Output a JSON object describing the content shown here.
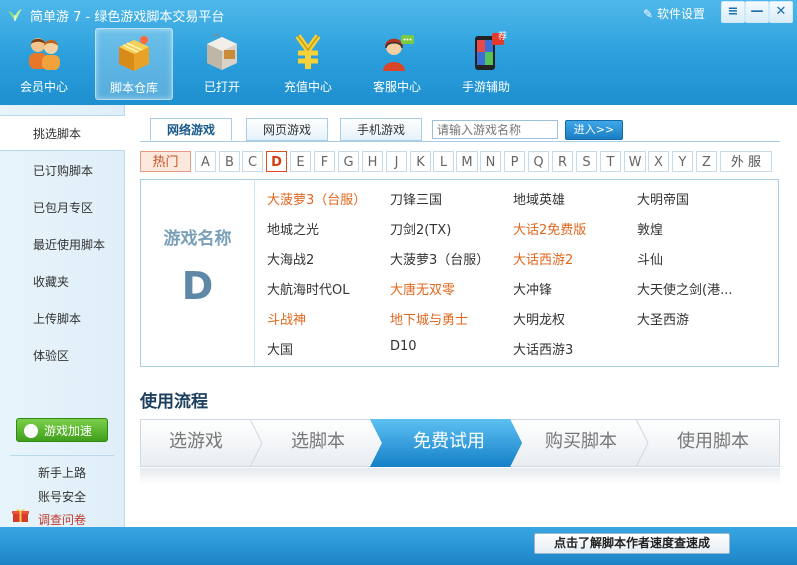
{
  "window": {
    "title": "简单游 7 - 绿色游戏脚本交易平台",
    "settings_label": "软件设置",
    "controls": [
      "≡",
      "—",
      "✕"
    ]
  },
  "nav": [
    {
      "label": "会员中心",
      "icon": "members-icon"
    },
    {
      "label": "脚本仓库",
      "icon": "script-warehouse-icon",
      "active": true
    },
    {
      "label": "已打开",
      "icon": "opened-scripts-icon"
    },
    {
      "label": "充值中心",
      "icon": "recharge-yuan-icon"
    },
    {
      "label": "客服中心",
      "icon": "customer-service-icon"
    },
    {
      "label": "手游辅助",
      "icon": "mobile-game-icon",
      "badge": "荐"
    }
  ],
  "sidebar": {
    "items": [
      "挑选脚本",
      "已订购脚本",
      "已包月专区",
      "最近使用脚本",
      "收藏夹",
      "上传脚本",
      "体验区"
    ],
    "accelerate_label": "游戏加速",
    "links": [
      "新手上路",
      "账号安全",
      "调查问卷"
    ]
  },
  "tabs": [
    "网络游戏",
    "网页游戏",
    "手机游戏"
  ],
  "search": {
    "placeholder": "请输入游戏名称",
    "enter_label": "进入>>"
  },
  "letters": {
    "hot": "热门",
    "items": [
      "A",
      "B",
      "C",
      "D",
      "E",
      "F",
      "G",
      "H",
      "J",
      "K",
      "L",
      "M",
      "N",
      "P",
      "Q",
      "R",
      "S",
      "T",
      "W",
      "X",
      "Y",
      "Z"
    ],
    "selected": "D",
    "foreign": "外 服"
  },
  "games_panel": {
    "title": "游戏名称",
    "letter": "D",
    "games": [
      {
        "name": "大菠萝3（台服）",
        "hot": true
      },
      {
        "name": "刀锋三国",
        "hot": false
      },
      {
        "name": "地域英雄",
        "hot": false
      },
      {
        "name": "大明帝国",
        "hot": false
      },
      {
        "name": "地城之光",
        "hot": false
      },
      {
        "name": "刀剑2(TX)",
        "hot": false
      },
      {
        "name": "大话2免费版",
        "hot": true
      },
      {
        "name": "敦煌",
        "hot": false
      },
      {
        "name": "大海战2",
        "hot": false
      },
      {
        "name": "大菠萝3（台服）",
        "hot": false
      },
      {
        "name": "大话西游2",
        "hot": true
      },
      {
        "name": "斗仙",
        "hot": false
      },
      {
        "name": "大航海时代OL",
        "hot": false
      },
      {
        "name": "大唐无双零",
        "hot": true
      },
      {
        "name": "大冲锋",
        "hot": false
      },
      {
        "name": "大天使之剑(港...",
        "hot": false
      },
      {
        "name": "斗战神",
        "hot": true
      },
      {
        "name": "地下城与勇士",
        "hot": true
      },
      {
        "name": "大明龙权",
        "hot": false
      },
      {
        "name": "大圣西游",
        "hot": false
      },
      {
        "name": "大国",
        "hot": false
      },
      {
        "name": "D10",
        "hot": false
      },
      {
        "name": "大话西游3",
        "hot": false
      }
    ]
  },
  "flow": {
    "title": "使用流程",
    "steps": [
      "选游戏",
      "选脚本",
      "免费试用",
      "购买脚本",
      "使用脚本"
    ],
    "active_index": 2
  },
  "footer": {
    "notice": "点击了解脚本作者速度查速成"
  },
  "colors": {
    "accent": "#2a9fdc",
    "hot_text": "#e2671d",
    "active_step": "#1c93d6"
  }
}
